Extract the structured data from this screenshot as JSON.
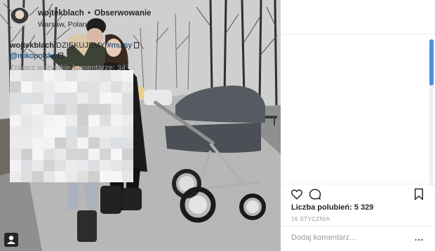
{
  "post": {
    "username": "wojtekblach",
    "separator": "•",
    "follow_label": "Obserwowanie",
    "location": "Warsaw, Poland",
    "caption_user": "wojtekblach",
    "caption_text": "DZIĘKUJEMY",
    "hashtag": "#mutsy",
    "mention": "@mikopolska",
    "view_all_comments": "Zobacz wszystkie komentarze: 34",
    "likes": "Liczba polubień: 5 329",
    "date": "16 STYCZNIA",
    "comment_placeholder": "Dodaj komentarz...",
    "more_label": "..."
  },
  "icons": {
    "like": "heart-icon",
    "comment": "speech-bubble-icon",
    "save": "bookmark-icon",
    "photo_badge": "user-tag-icon"
  },
  "colors": {
    "link": "#003569",
    "muted": "#999999",
    "scroll_thumb": "#4a90e2"
  }
}
